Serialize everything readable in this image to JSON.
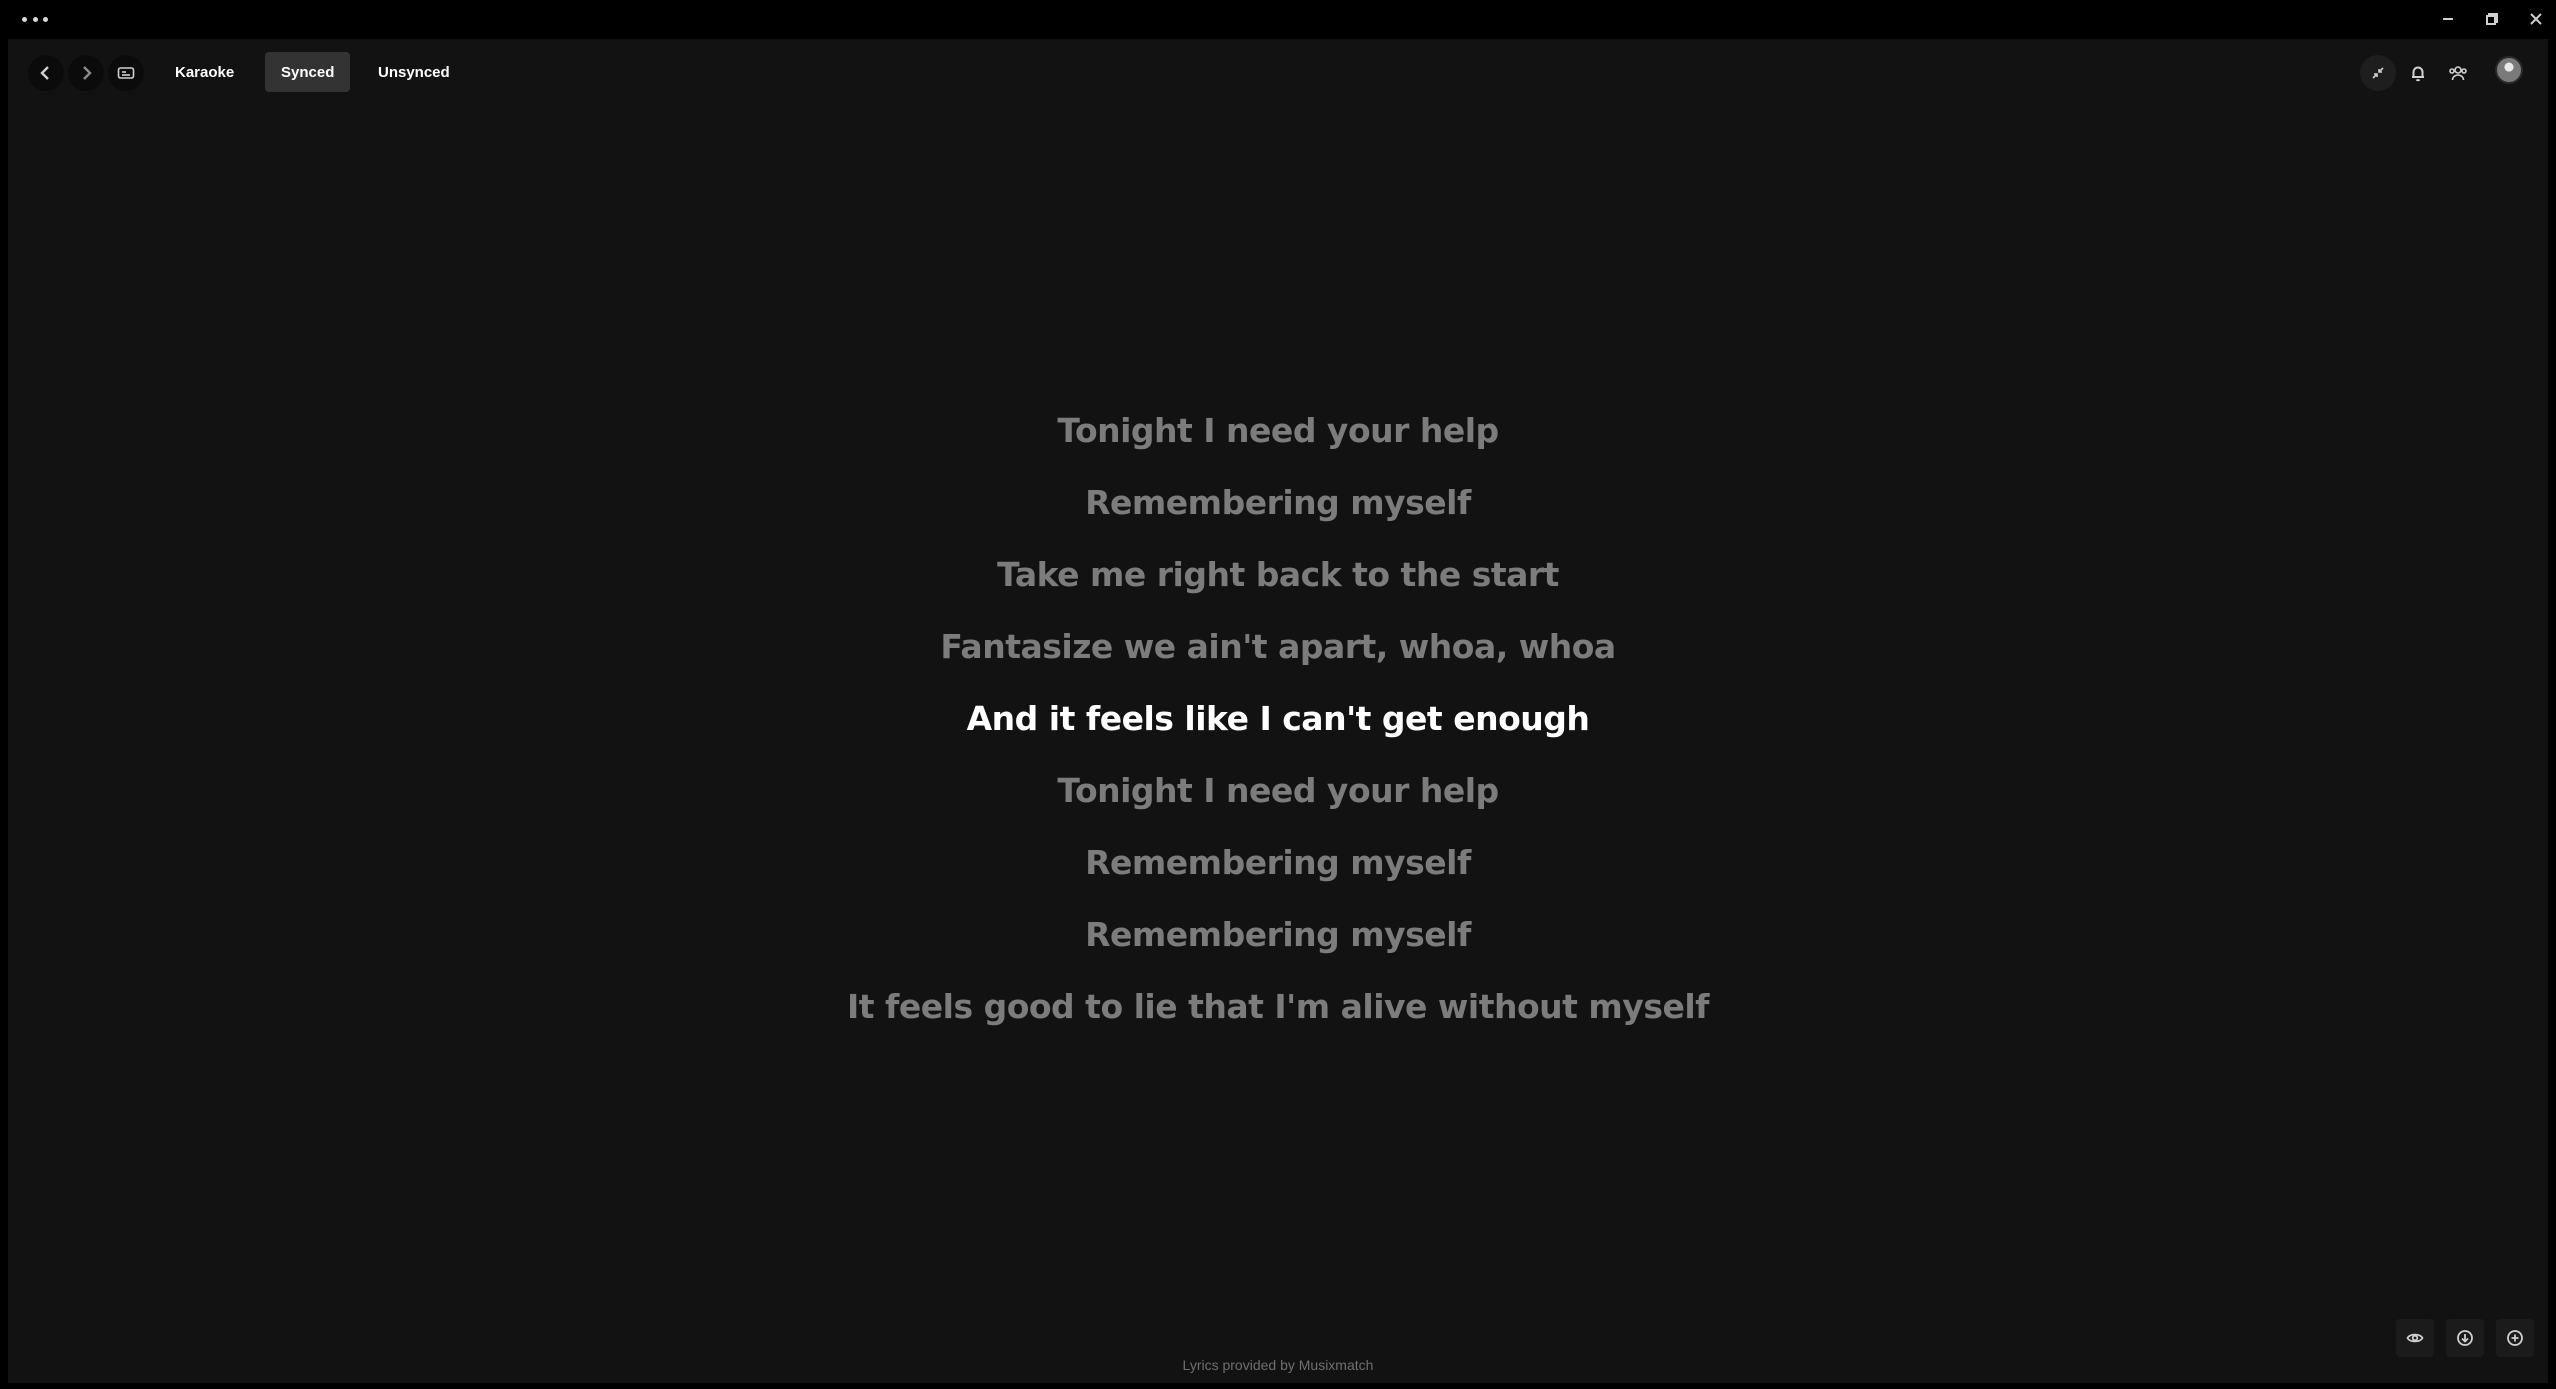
{
  "window": {
    "menu_icon": "more-dots-icon",
    "minimize_icon": "minimize-icon",
    "restore_icon": "restore-icon",
    "close_icon": "close-icon"
  },
  "topbar": {
    "back_icon": "chevron-left-icon",
    "forward_icon": "chevron-right-icon",
    "tabs": [
      {
        "label": "Karaoke",
        "active": false
      },
      {
        "label": "Synced",
        "active": true
      },
      {
        "label": "Unsynced",
        "active": false
      }
    ],
    "right_icons": [
      "collapse-icon",
      "bell-icon",
      "friends-icon",
      "avatar"
    ]
  },
  "lyrics": {
    "lines": [
      "Tonight I need your help",
      "Remembering myself",
      "Take me right back to the start",
      "Fantasize we ain't apart, whoa, whoa",
      "And it feels like I can't get enough",
      "Tonight I need your help",
      "Remembering myself",
      "Remembering myself",
      "It feels good to lie that I'm alive without myself"
    ],
    "active_index": 4,
    "active_color": "#ffffff",
    "inactive_color": "#7c7c7c"
  },
  "footer": {
    "credit": "Lyrics provided by Musixmatch",
    "controls": [
      "eye-icon",
      "download-icon",
      "add-icon"
    ]
  }
}
